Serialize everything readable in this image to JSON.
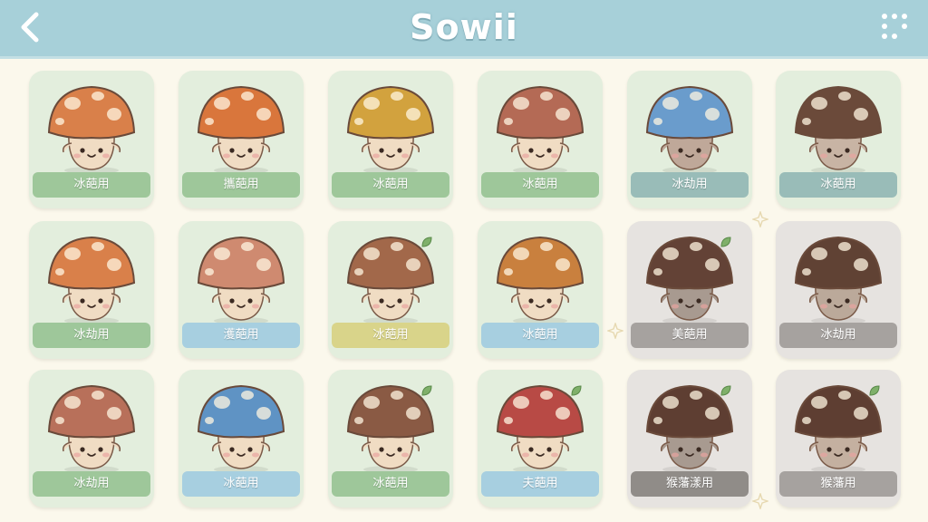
{
  "header": {
    "title": "Sowii",
    "back_icon": "back-arrow-icon",
    "menu_icon": "dots-grid-icon"
  },
  "colors": {
    "header_bg": "#a7d0d9",
    "page_bg": "#fbf8ec"
  },
  "cards": [
    {
      "label": "冰葩用",
      "cap": "#d9804a",
      "card": "#e3eedd",
      "label_bg": "#9ec79a",
      "body": "#f0dcc3",
      "leaf": false
    },
    {
      "label": "攜葩用",
      "cap": "#d9763c",
      "card": "#e3eedd",
      "label_bg": "#9ec79a",
      "body": "#f0dcc3",
      "leaf": false
    },
    {
      "label": "冰葩用",
      "cap": "#d2a23e",
      "card": "#e3eedd",
      "label_bg": "#9ec79a",
      "body": "#f0dcc3",
      "leaf": false
    },
    {
      "label": "冰葩用",
      "cap": "#b46a55",
      "card": "#e3eedd",
      "label_bg": "#9ec79a",
      "body": "#f0dcc3",
      "leaf": false
    },
    {
      "label": "冰劫用",
      "cap": "#6a9ccc",
      "card": "#e3eedd",
      "label_bg": "#99bcb8",
      "body": "#bfa899",
      "leaf": false
    },
    {
      "label": "冰葩用",
      "cap": "#6b4a3a",
      "card": "#e3eedd",
      "label_bg": "#99bcb8",
      "body": "#c8b4a4",
      "leaf": false
    },
    {
      "label": "冰劫用",
      "cap": "#d9804a",
      "card": "#e3eedd",
      "label_bg": "#9ec79a",
      "body": "#f0dcc3",
      "leaf": false
    },
    {
      "label": "濩葩用",
      "cap": "#cf8a70",
      "card": "#e3eedd",
      "label_bg": "#a7cfe0",
      "body": "#f0dcc3",
      "leaf": false
    },
    {
      "label": "冰葩用",
      "cap": "#a2684a",
      "card": "#e3eedd",
      "label_bg": "#d9d48a",
      "body": "#f0dcc3",
      "leaf": true
    },
    {
      "label": "冰葩用",
      "cap": "#c9803e",
      "card": "#e3eedd",
      "label_bg": "#a7cfe0",
      "body": "#f0dcc3",
      "leaf": false
    },
    {
      "label": "美葩用",
      "cap": "#634236",
      "card": "#e6e3e0",
      "label_bg": "#a6a29f",
      "body": "#a89a90",
      "leaf": true
    },
    {
      "label": "冰劫用",
      "cap": "#604234",
      "card": "#e6e3e0",
      "label_bg": "#a6a29f",
      "body": "#bba99a",
      "leaf": false
    },
    {
      "label": "冰劫用",
      "cap": "#b8705a",
      "card": "#e3eedd",
      "label_bg": "#9ec79a",
      "body": "#f0dcc3",
      "leaf": false
    },
    {
      "label": "冰葩用",
      "cap": "#5f93c4",
      "card": "#e3eedd",
      "label_bg": "#a7cfe0",
      "body": "#f0dcc3",
      "leaf": false
    },
    {
      "label": "冰葩用",
      "cap": "#8a5a44",
      "card": "#e3eedd",
      "label_bg": "#9ec79a",
      "body": "#f0dcc3",
      "leaf": true
    },
    {
      "label": "夫葩用",
      "cap": "#b84a45",
      "card": "#e3eedd",
      "label_bg": "#a7cfe0",
      "body": "#f0dcc3",
      "leaf": true
    },
    {
      "label": "猴藩漾用",
      "cap": "#5e3e32",
      "card": "#e6e3e0",
      "label_bg": "#908c88",
      "body": "#a89a90",
      "leaf": true
    },
    {
      "label": "猴藩用",
      "cap": "#5e3e32",
      "card": "#e6e3e0",
      "label_bg": "#a6a29f",
      "body": "#c4b0a0",
      "leaf": true
    }
  ]
}
